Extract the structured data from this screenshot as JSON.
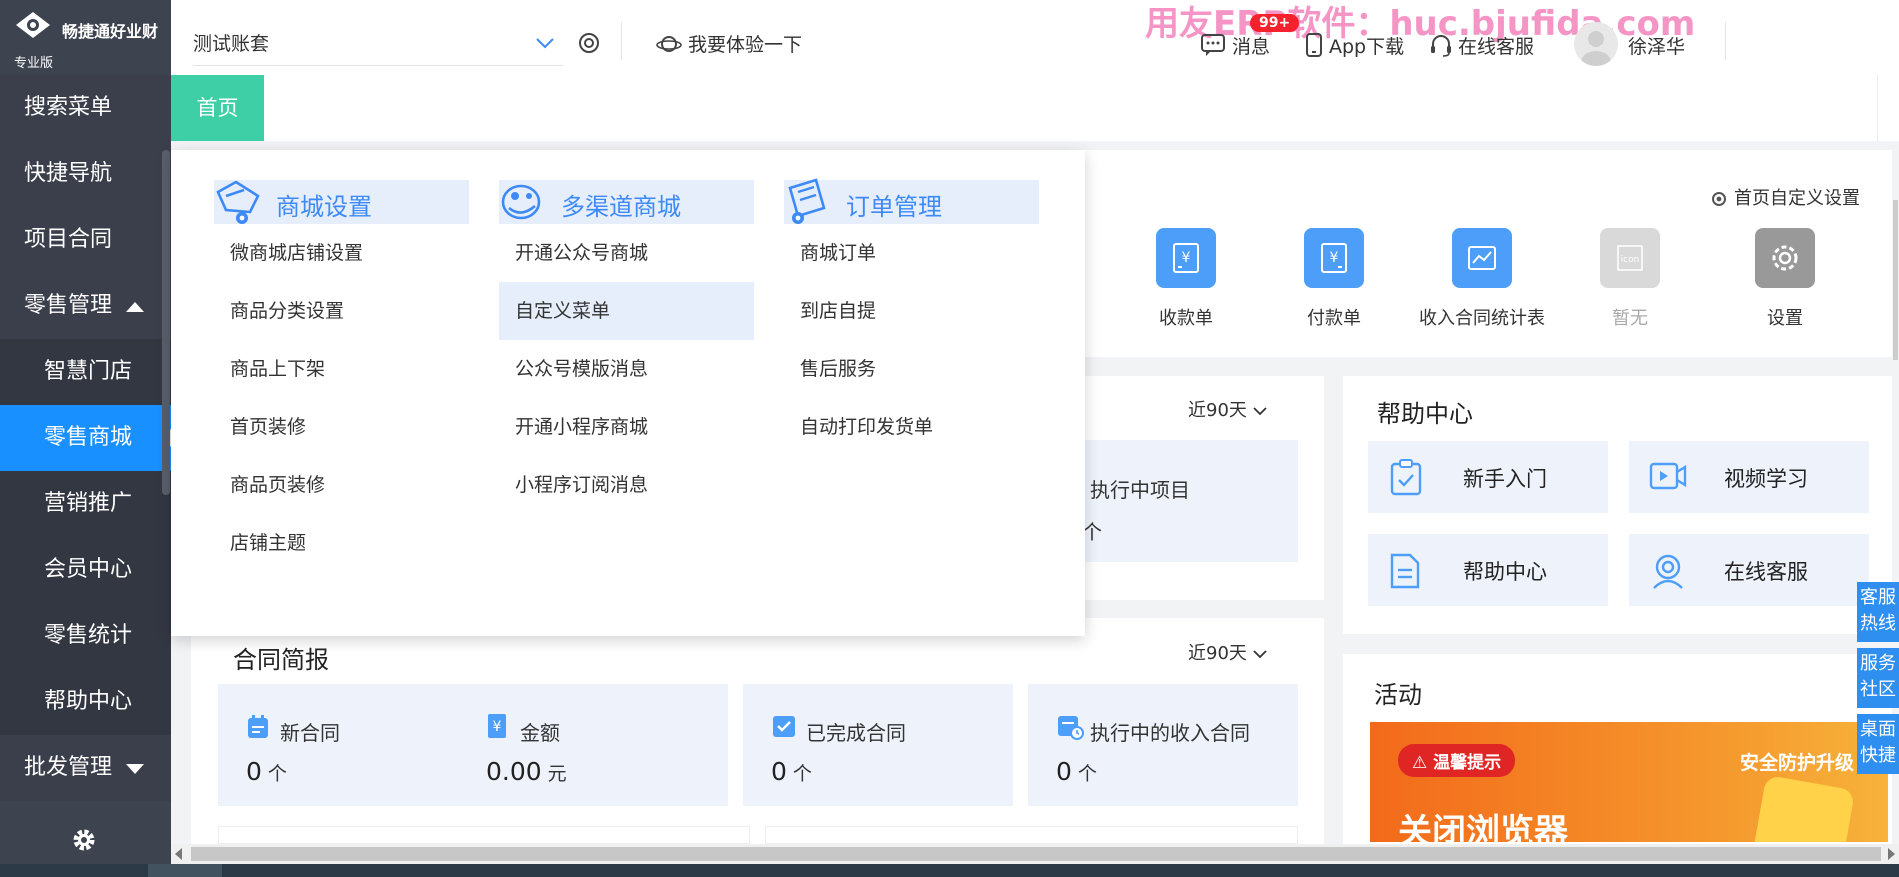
{
  "app": {
    "brand": "畅捷通好业财",
    "edition": "专业版"
  },
  "sidebar": {
    "items": [
      {
        "label": "搜索菜单"
      },
      {
        "label": "快捷导航"
      },
      {
        "label": "项目合同"
      },
      {
        "label": "零售管理",
        "expanded": true
      },
      {
        "label": "智慧门店"
      },
      {
        "label": "零售商城",
        "active": true
      },
      {
        "label": "营销推广"
      },
      {
        "label": "会员中心"
      },
      {
        "label": "零售统计"
      },
      {
        "label": "帮助中心"
      },
      {
        "label": "批发管理",
        "expanded": false
      }
    ]
  },
  "topbar": {
    "account": "测试账套",
    "try_label": "我要体验一下",
    "watermark": "用友ERP软件：huc.bjufida.com",
    "message_label": "消息",
    "message_badge": "99+",
    "app_label": "App下载",
    "service_label": "在线客服",
    "username": "徐泽华"
  },
  "tabs": {
    "home": "首页"
  },
  "quick": {
    "custom_settings": "首页自定义设置",
    "items": [
      {
        "label": "收款单",
        "icon": "receipt-icon",
        "color": "#4d9ef8"
      },
      {
        "label": "付款单",
        "icon": "payment-icon",
        "color": "#4d9ef8"
      },
      {
        "label": "收入合同统计表",
        "icon": "chart-report-icon",
        "color": "#4d9ef8"
      },
      {
        "label": "暂无",
        "icon": "placeholder-icon",
        "color": "#d9d9d9"
      },
      {
        "label": "设置",
        "icon": "gear-icon",
        "color": "#999999"
      }
    ]
  },
  "project": {
    "range": "近90天",
    "executing_label": "执行中项目",
    "executing_unit": "个"
  },
  "contract": {
    "title": "合同简报",
    "range": "近90天",
    "new_label": "新合同",
    "new_value": "0",
    "new_unit": "个",
    "amount_label": "金额",
    "amount_value": "0.00",
    "amount_unit": "元",
    "done_label": "已完成合同",
    "done_value": "0",
    "done_unit": "个",
    "running_label": "执行中的收入合同",
    "running_value": "0",
    "running_unit": "个"
  },
  "help": {
    "title": "帮助中心",
    "tiles": [
      {
        "label": "新手入门",
        "icon": "clipboard-check-icon"
      },
      {
        "label": "视频学习",
        "icon": "video-icon"
      },
      {
        "label": "帮助中心",
        "icon": "document-icon"
      },
      {
        "label": "在线客服",
        "icon": "headset-user-icon"
      }
    ]
  },
  "activity": {
    "title": "活动",
    "tip": "温馨提示",
    "safe": "安全防护升级",
    "big": "关闭浏览器"
  },
  "float_buttons": [
    "客服热线",
    "服务社区",
    "桌面快捷"
  ],
  "dropdown": {
    "columns": [
      {
        "title": "商城设置",
        "icon": "shop-settings-icon",
        "items": [
          "微商城店铺设置",
          "商品分类设置",
          "商品上下架",
          "首页装修",
          "商品页装修",
          "店铺主题"
        ]
      },
      {
        "title": "多渠道商城",
        "icon": "multichannel-icon",
        "items": [
          "开通公众号商城",
          "自定义菜单",
          "公众号模版消息",
          "开通小程序商城",
          "小程序订阅消息"
        ],
        "highlighted": "自定义菜单"
      },
      {
        "title": "订单管理",
        "icon": "order-manage-icon",
        "items": [
          "商城订单",
          "到店自提",
          "售后服务",
          "自动打印发货单"
        ]
      }
    ]
  },
  "colors": {
    "sidebar_bg": "#3e4350",
    "active_blue": "#1890ff",
    "home_tab": "#3fcfa6",
    "accent_blue": "#3d8af7"
  }
}
